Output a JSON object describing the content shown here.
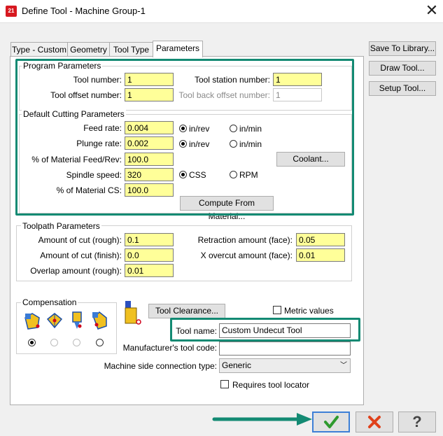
{
  "window": {
    "title": "Define Tool - Machine Group-1",
    "app_icon": "21"
  },
  "tabs": [
    {
      "label": "Type - Custom"
    },
    {
      "label": "Geometry"
    },
    {
      "label": "Tool Type"
    },
    {
      "label": "Parameters"
    }
  ],
  "active_tab": "Parameters",
  "side_buttons": {
    "save": "Save To Library...",
    "draw": "Draw Tool...",
    "setup": "Setup Tool..."
  },
  "program_params": {
    "title": "Program Parameters",
    "tool_number_label": "Tool number:",
    "tool_number": "1",
    "tool_station_label": "Tool station number:",
    "tool_station": "1",
    "tool_offset_label": "Tool offset number:",
    "tool_offset": "1",
    "tool_back_offset_label": "Tool back offset number:",
    "tool_back_offset": "1"
  },
  "cutting_params": {
    "title": "Default Cutting Parameters",
    "feed_rate_label": "Feed rate:",
    "feed_rate": "0.004",
    "plunge_rate_label": "Plunge rate:",
    "plunge_rate": "0.002",
    "material_feed_label": "% of Material Feed/Rev:",
    "material_feed": "100.0",
    "spindle_label": "Spindle speed:",
    "spindle": "320",
    "material_cs_label": "% of Material CS:",
    "material_cs": "100.0",
    "in_rev": "in/rev",
    "in_min": "in/min",
    "css": "CSS",
    "rpm": "RPM",
    "coolant_button": "Coolant...",
    "compute_button": "Compute From Material..."
  },
  "toolpath_params": {
    "title": "Toolpath Parameters",
    "cut_rough_label": "Amount of cut (rough):",
    "cut_rough": "0.1",
    "cut_finish_label": "Amount of cut (finish):",
    "cut_finish": "0.0",
    "overlap_label": "Overlap amount (rough):",
    "overlap": "0.01",
    "retraction_label": "Retraction amount (face):",
    "retraction": "0.05",
    "overcut_label": "X overcut amount (face):",
    "overcut": "0.01"
  },
  "compensation": {
    "title": "Compensation",
    "selected_index": 0
  },
  "tool_clearance_button": "Tool Clearance...",
  "metric_values_label": "Metric values",
  "tool_name_label": "Tool name:",
  "tool_name": "Custom Undecut Tool",
  "manufacturer_label": "Manufacturer's tool code:",
  "manufacturer_code": "",
  "machine_side_label": "Machine side connection type:",
  "machine_side": "Generic",
  "requires_locator_label": "Requires tool locator",
  "footer_buttons": {
    "ok_icon": "checkmark-icon",
    "cancel_icon": "cross-icon",
    "help_icon": "question-icon"
  },
  "colors": {
    "highlight": "#138a73",
    "field_yellow": "#ffff99",
    "cancel_red": "#e0411b",
    "ok_green": "#2e9a2e"
  }
}
